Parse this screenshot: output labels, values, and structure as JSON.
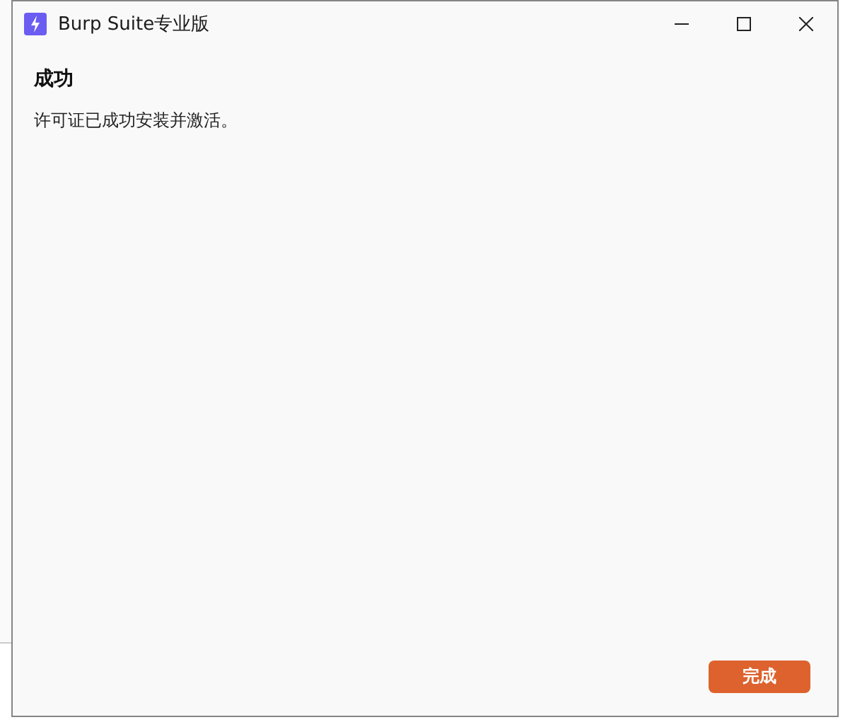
{
  "window": {
    "title": "Burp Suite专业版"
  },
  "content": {
    "heading": "成功",
    "message": "许可证已成功安装并激活。"
  },
  "buttons": [
    {
      "label": "完成"
    }
  ]
}
